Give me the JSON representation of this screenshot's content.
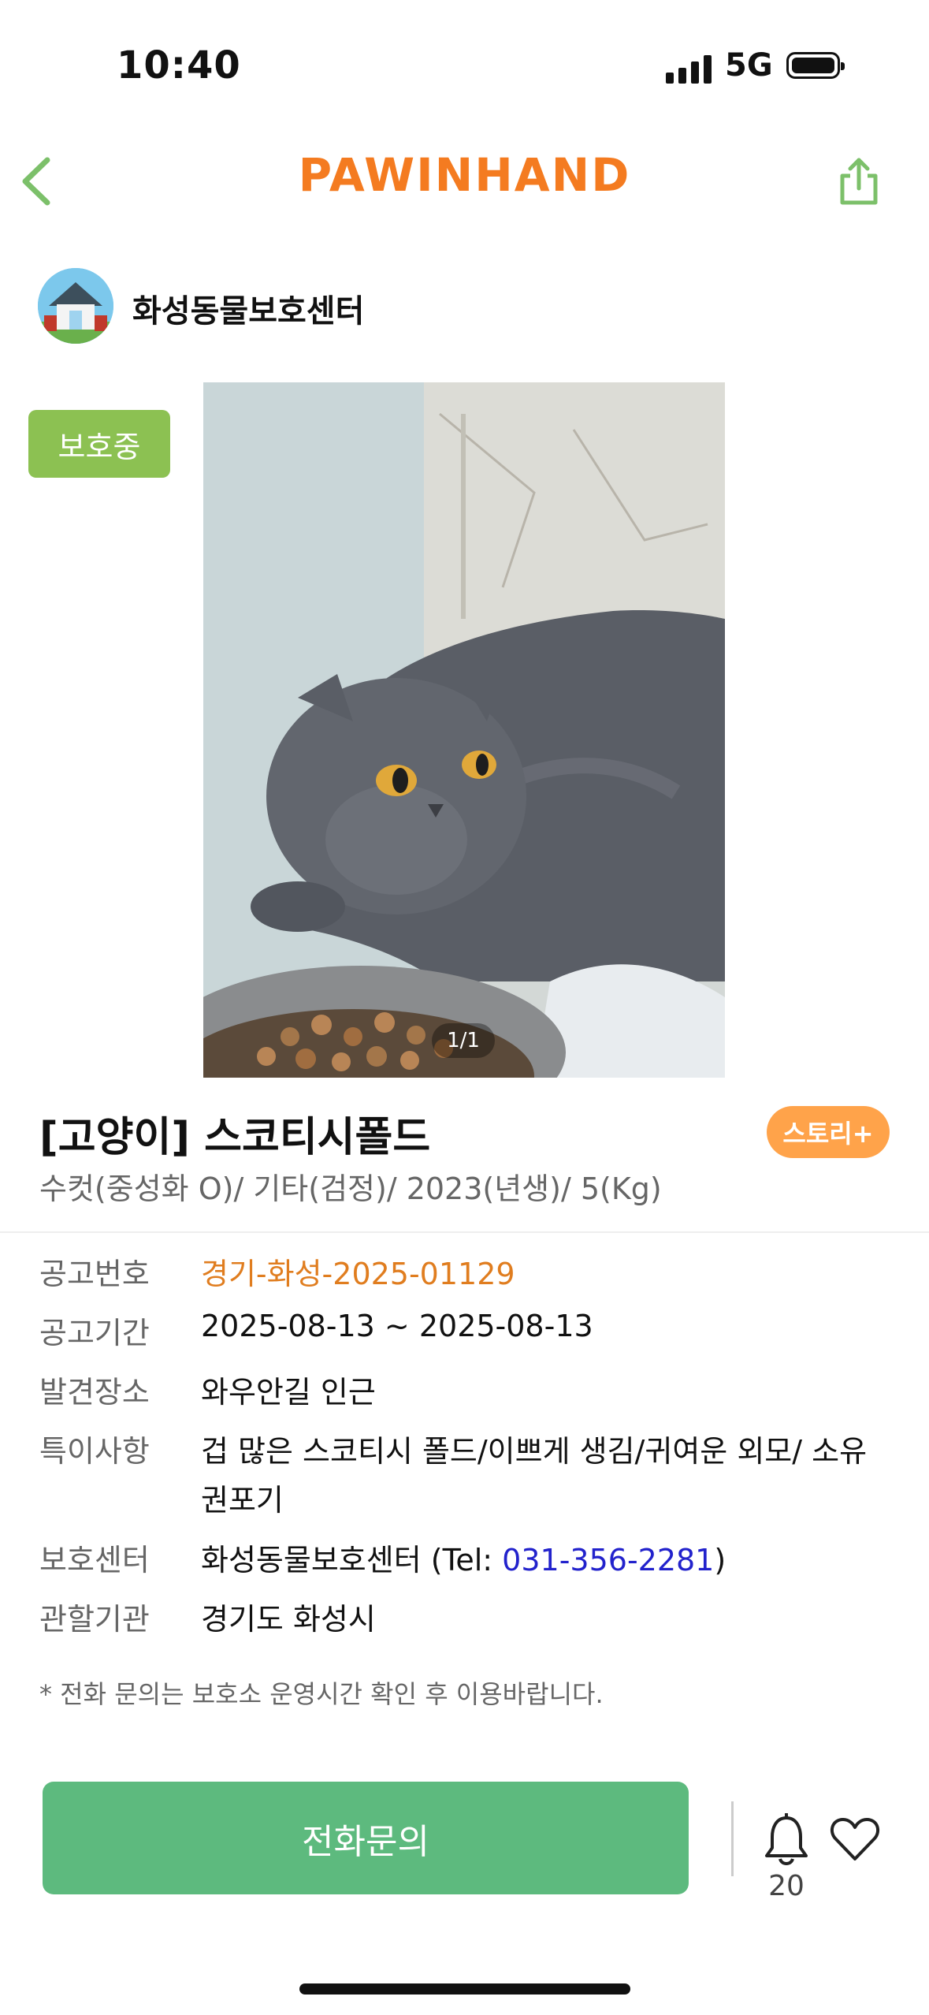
{
  "status_bar": {
    "time": "10:40",
    "network": "5G"
  },
  "nav": {
    "logo": "PAWINHAND",
    "back_icon": "chevron-left-icon",
    "share_icon": "share-icon"
  },
  "shelter": {
    "name": "화성동물보호센터"
  },
  "status_badge": "보호중",
  "photo": {
    "counter": "1/1"
  },
  "animal": {
    "title": "[고양이] 스코티시폴드",
    "subtitle": "수컷(중성화 O)/ 기타(검정)/ 2023(년생)/ 5(Kg)",
    "story_button": "스토리+"
  },
  "details": {
    "notice_no": {
      "label": "공고번호",
      "value": "경기-화성-2025-01129"
    },
    "notice_period": {
      "label": "공고기간",
      "value": "2025-08-13 ~ 2025-08-13"
    },
    "found_place": {
      "label": "발견장소",
      "value": "와우안길 인근"
    },
    "features": {
      "label": "특이사항",
      "value_line1": "겁 많은 스코티시 폴드/이쁘게 생김/귀여운 외모/ 소유",
      "value_line2": "권포기"
    },
    "center": {
      "label": "보호센터",
      "name": "화성동물보호센터 (Tel: ",
      "phone": "031-356-2281",
      "close": ")"
    },
    "authority": {
      "label": "관할기관",
      "value": "경기도 화성시"
    }
  },
  "notice": "* 전화 문의는 보호소 운영시간 확인 후 이용바랍니다.",
  "actions": {
    "call_button": "전화문의",
    "alert_count": "20"
  },
  "colors": {
    "brand": "#f47b20",
    "green_button": "#5dba7e",
    "badge": "#8cc152",
    "story": "#ffa34a",
    "link": "#2222cc"
  }
}
